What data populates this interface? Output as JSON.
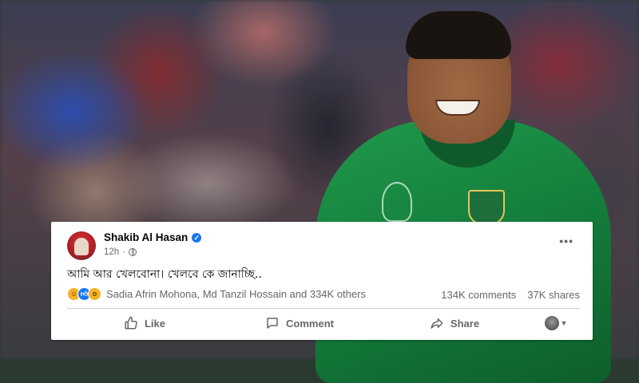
{
  "post": {
    "author": "Shakib Al Hasan",
    "verified_icon": "verified-badge-icon",
    "timestamp": "12h",
    "audience_icon": "globe-icon",
    "text": "আমি আর খেলবোনা। খেলবে কে জানাচ্ছি..",
    "reaction_icons": [
      "haha-icon",
      "like-icon",
      "wow-icon"
    ],
    "reaction_names": "Sadia Afrin Mohona, Md Tanzil Hossain and 334K others",
    "comments": "134K comments",
    "shares": "37K shares"
  },
  "actions": {
    "like": "Like",
    "comment": "Comment",
    "share": "Share"
  },
  "colors": {
    "facebook_blue": "#1877f2",
    "secondary_text": "#65676b",
    "jersey_green": "#137a3a"
  }
}
